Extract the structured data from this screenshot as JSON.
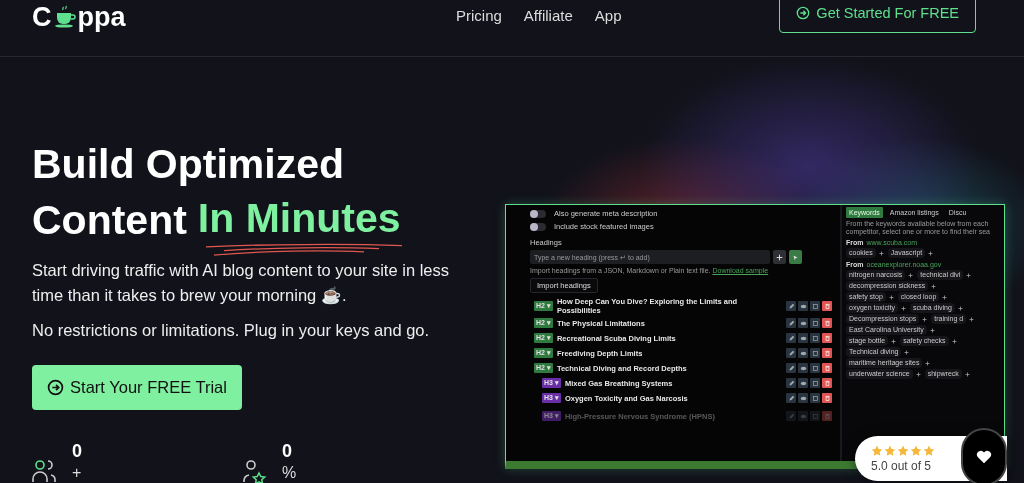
{
  "header": {
    "logo_start": "C",
    "logo_end": "ppa",
    "nav": [
      "Pricing",
      "Affiliate",
      "App"
    ],
    "cta": "Get Started For FREE"
  },
  "hero": {
    "title_line1": "Build Optimized",
    "title_line2": "Content",
    "highlight": "In Minutes",
    "paragraphs": [
      "Start driving traffic with AI blog content to your site in less time than it takes to brew your morning ☕.",
      "No restrictions or limitations. Plug in your keys and go."
    ],
    "trial_button": "Start Your FREE Trial"
  },
  "stats": [
    {
      "kind": "users",
      "value": "0",
      "suffix": "+"
    },
    {
      "kind": "user-star",
      "value": "0",
      "suffix": "%"
    }
  ],
  "app_preview": {
    "toggles": [
      {
        "label": "Also generate meta description",
        "on": false
      },
      {
        "label": "Include stock featured images",
        "on": false
      }
    ],
    "headings_label": "Headings",
    "heading_input": {
      "placeholder": "Type a new heading (press ↵ to add)"
    },
    "import_hint": "Import headings from a JSON, Markdown or Plain text file.",
    "import_link": "Download sample",
    "import_button": "Import headings",
    "headings": [
      {
        "level": "H2 ▾",
        "kind": "h2",
        "text": "How Deep Can You Dive? Exploring the Limits and Possibilities",
        "faded": false
      },
      {
        "level": "H2 ▾",
        "kind": "h2",
        "text": "The Physical Limitations",
        "faded": false
      },
      {
        "level": "H2 ▾",
        "kind": "h2",
        "text": "Recreational Scuba Diving Limits",
        "faded": false
      },
      {
        "level": "H2 ▾",
        "kind": "h2",
        "text": "Freediving Depth Limits",
        "faded": false
      },
      {
        "level": "H2 ▾",
        "kind": "h2",
        "text": "Technical Diving and Record Depths",
        "faded": false
      },
      {
        "level": "H3 ▾",
        "kind": "h3",
        "text": "Mixed Gas Breathing Systems",
        "faded": false
      },
      {
        "level": "H3 ▾",
        "kind": "h3",
        "text": "Oxygen Toxicity and Gas Narcosis",
        "faded": false
      },
      {
        "level": "H3 ▾",
        "kind": "h3",
        "text": "High-Pressure Nervous Syndrome (HPNS)",
        "faded": true
      }
    ],
    "side_tabs": [
      {
        "label": "Keywords",
        "selected": true
      },
      {
        "label": "Amazon listings",
        "selected": false
      },
      {
        "label": "Discu",
        "selected": false
      }
    ],
    "side_intro": "From the keywords available below from each competitor, select one or more to find their sea",
    "sources": [
      {
        "from": "From",
        "domain": "www.scuba.com",
        "keyword_rows": [
          [
            "cookies",
            "Javascript"
          ]
        ]
      },
      {
        "from": "From",
        "domain": "oceanexplorer.noaa.gov",
        "keyword_rows": [
          [
            "nitrogen narcosis",
            "technical divi"
          ],
          [
            "decompression sickness"
          ],
          [
            "safety stop",
            "closed loop"
          ],
          [
            "oxygen toxicity",
            "scuba diving"
          ],
          [
            "Decompression stops",
            "training d"
          ],
          [
            "East Carolina University"
          ],
          [
            "stage bottle",
            "safety checks"
          ],
          [
            "Technical diving"
          ],
          [
            "maritime heritage sites"
          ],
          [
            "underwater science",
            "shipwreck"
          ]
        ]
      }
    ]
  },
  "rating": {
    "stars": 5,
    "text": "5.0 out of 5"
  }
}
